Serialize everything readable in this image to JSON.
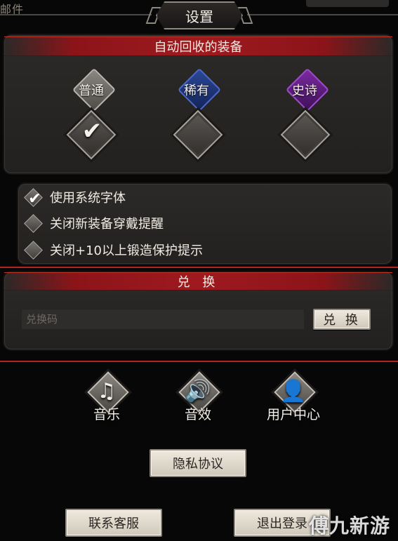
{
  "header": {
    "top_left_text": "邮件",
    "title": "设置"
  },
  "recycle": {
    "title": "自动回收的装备",
    "rarities": [
      {
        "label": "普通",
        "checked": true,
        "color": "#8b8882"
      },
      {
        "label": "稀有",
        "checked": false,
        "color": "#2c4796"
      },
      {
        "label": "史诗",
        "checked": false,
        "color": "#7b2aa0"
      }
    ]
  },
  "options": [
    {
      "label": "使用系统字体",
      "checked": true
    },
    {
      "label": "关闭新装备穿戴提醒",
      "checked": false
    },
    {
      "label": "关闭+10以上锻造保护提示",
      "checked": false
    }
  ],
  "redeem": {
    "title": "兑 换",
    "placeholder": "兑换码",
    "button_label": "兑 换"
  },
  "icons": {
    "music": {
      "label": "音乐",
      "icon": "music-note-icon",
      "glyph": "♫"
    },
    "sfx": {
      "label": "音效",
      "icon": "speaker-icon",
      "glyph": "🔊"
    },
    "user_center": {
      "label": "用户中心",
      "icon": "user-icon",
      "glyph": "👤"
    }
  },
  "buttons": {
    "privacy": "隐私协议",
    "contact": "联系客服",
    "logout": "退出登录"
  },
  "watermark": "傅九新游",
  "colors": {
    "accent_red": "#9e1a1f",
    "frame_red": "#b42424",
    "rare_blue": "#2c4796",
    "epic_purple": "#7b2aa0"
  }
}
